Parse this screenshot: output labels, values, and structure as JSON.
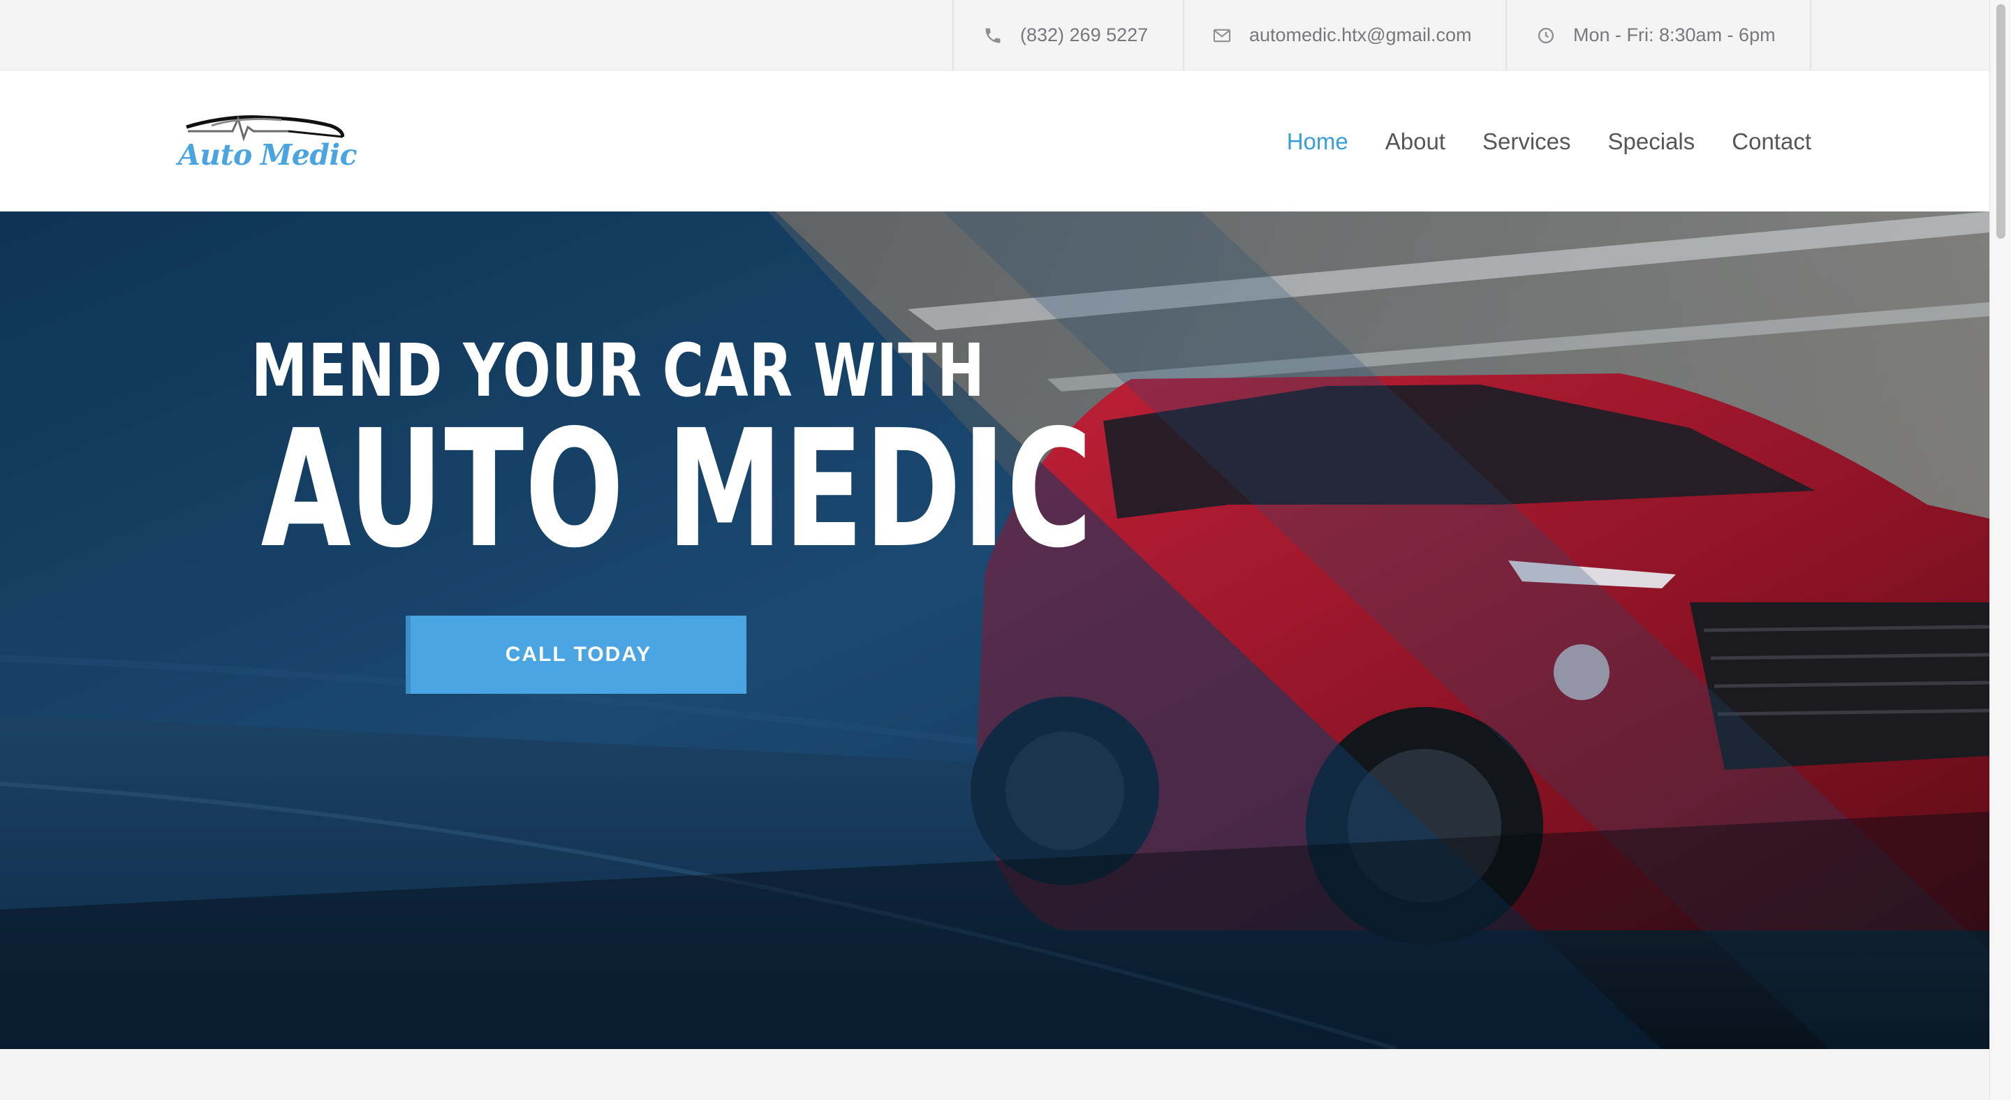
{
  "topbar": {
    "phone": {
      "icon": "phone-icon",
      "text": "(832) 269 5227"
    },
    "email": {
      "icon": "envelope-icon",
      "text": "automedic.htx@gmail.com"
    },
    "hours": {
      "icon": "clock-icon",
      "text": "Mon - Fri: 8:30am - 6pm"
    }
  },
  "header": {
    "logo": {
      "word1": "Auto",
      "word2": "Medic",
      "color": "#4aa4e0"
    },
    "nav": [
      {
        "label": "Home",
        "active": true
      },
      {
        "label": "About",
        "active": false
      },
      {
        "label": "Services",
        "active": false
      },
      {
        "label": "Specials",
        "active": false
      },
      {
        "label": "Contact",
        "active": false
      }
    ],
    "accent": "#3a9ddb"
  },
  "hero": {
    "headline_line1": "MEND YOUR CAR WITH",
    "headline_line2": "AUTO MEDIC",
    "cta_label": "CALL TODAY",
    "cta_color": "#4aa5e2"
  }
}
